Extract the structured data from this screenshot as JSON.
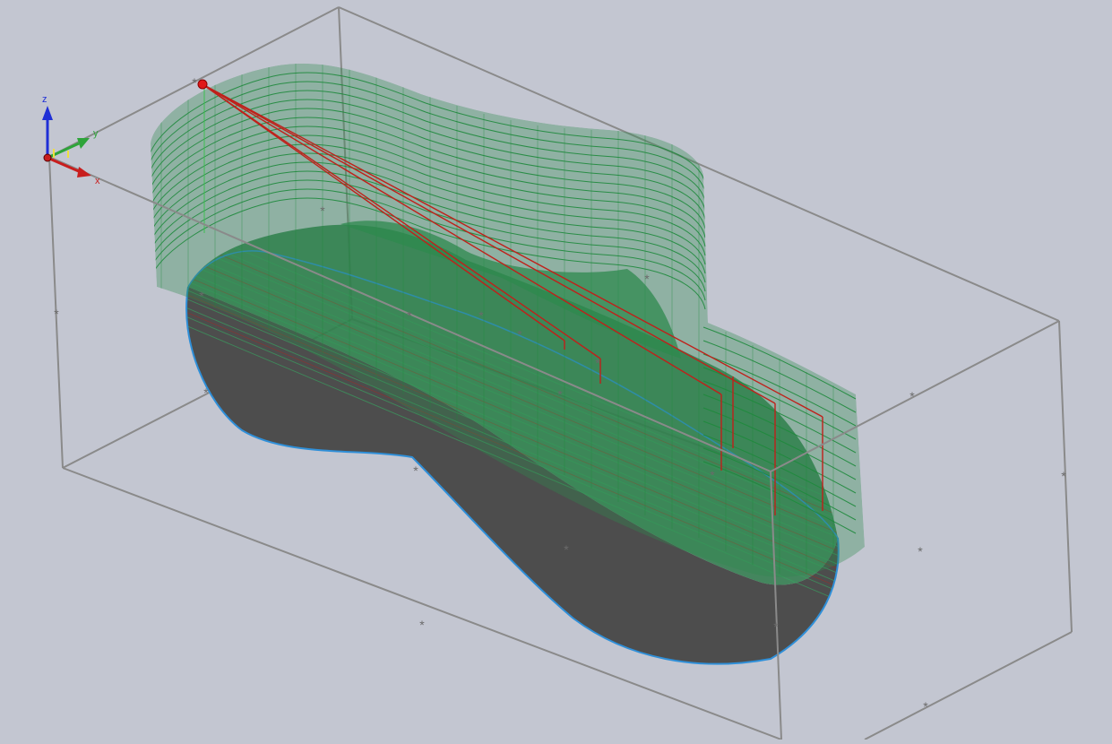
{
  "viewport": {
    "background": "#c3c6d1",
    "stock_box_color": "#808080",
    "part_top_color": "#2e7a4a",
    "part_side_color": "#4d4d4d",
    "part_edge_color": "#2f8fd8",
    "toolpath_color": "#1e8a3c",
    "rapid_move_color": "#c0201a"
  },
  "triad": {
    "z_label": "z",
    "y_label": "y",
    "x_label": "x",
    "z_color": "#1f2fd6",
    "y_color": "#2ea43a",
    "x_color": "#c81e1e"
  },
  "toolpath": {
    "start_point_icon": "start-point-icon",
    "pass_marker_icon": "asterisk-icon"
  }
}
